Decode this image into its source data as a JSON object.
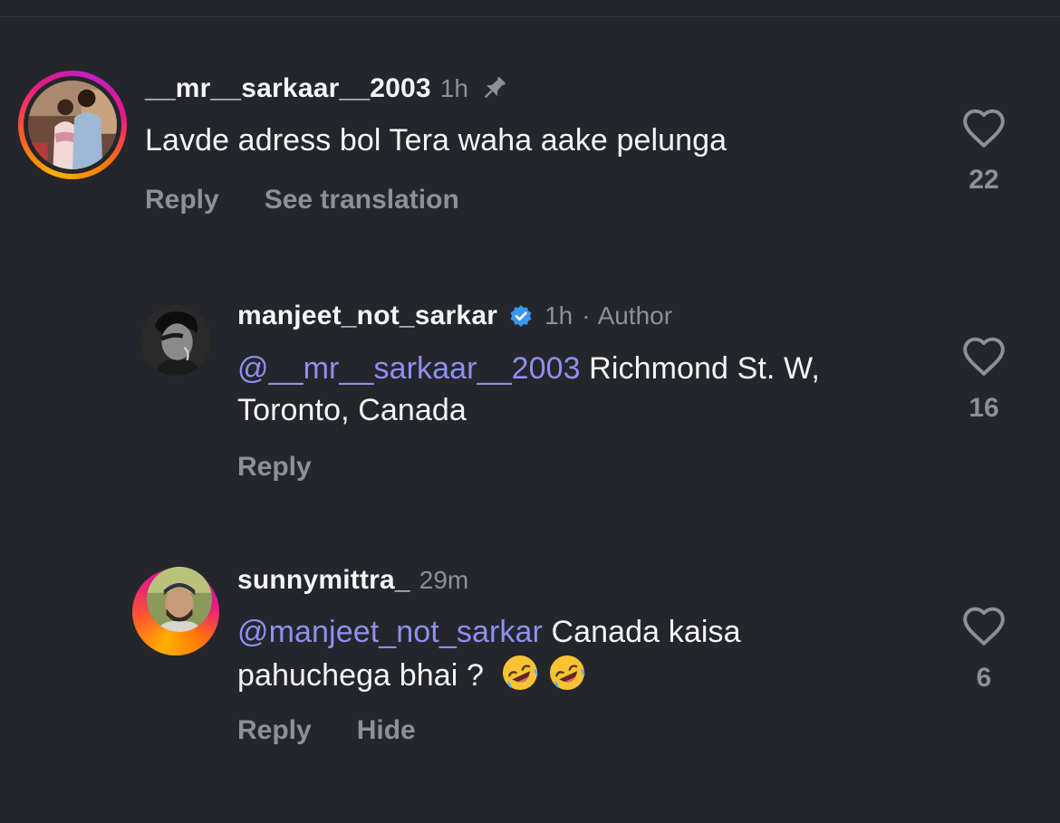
{
  "comments": [
    {
      "username": "__mr__sarkaar__2003",
      "time": "1h",
      "pinned": true,
      "text": "Lavde adress bol Tera waha aake pelunga",
      "actions": [
        "Reply",
        "See translation"
      ],
      "likes": "22",
      "avatar_icon": "profile-photo-couple"
    },
    {
      "username": "manjeet_not_sarkar",
      "verified": true,
      "time": "1h",
      "separator": "·",
      "badge": "Author",
      "mention": "@__mr__sarkaar__2003",
      "text": " Richmond St. W, Toronto, Canada",
      "actions": [
        "Reply"
      ],
      "likes": "16",
      "avatar_icon": "profile-photo-bw-portrait"
    },
    {
      "username": "sunnymittra_",
      "time": "29m",
      "mention": "@manjeet_not_sarkar",
      "text": " Canada kaisa pahuchega bhai ?",
      "emojis": [
        "rolling-on-floor-laughing-emoji",
        "rolling-on-floor-laughing-emoji"
      ],
      "actions": [
        "Reply",
        "Hide"
      ],
      "likes": "6",
      "avatar_icon": "profile-photo-man-cap"
    }
  ],
  "colors": {
    "background": "#24262b",
    "primary_text": "#f4f5f7",
    "secondary_text": "#8e9096",
    "mention": "#8f8ff0",
    "verified": "#3897f0"
  }
}
